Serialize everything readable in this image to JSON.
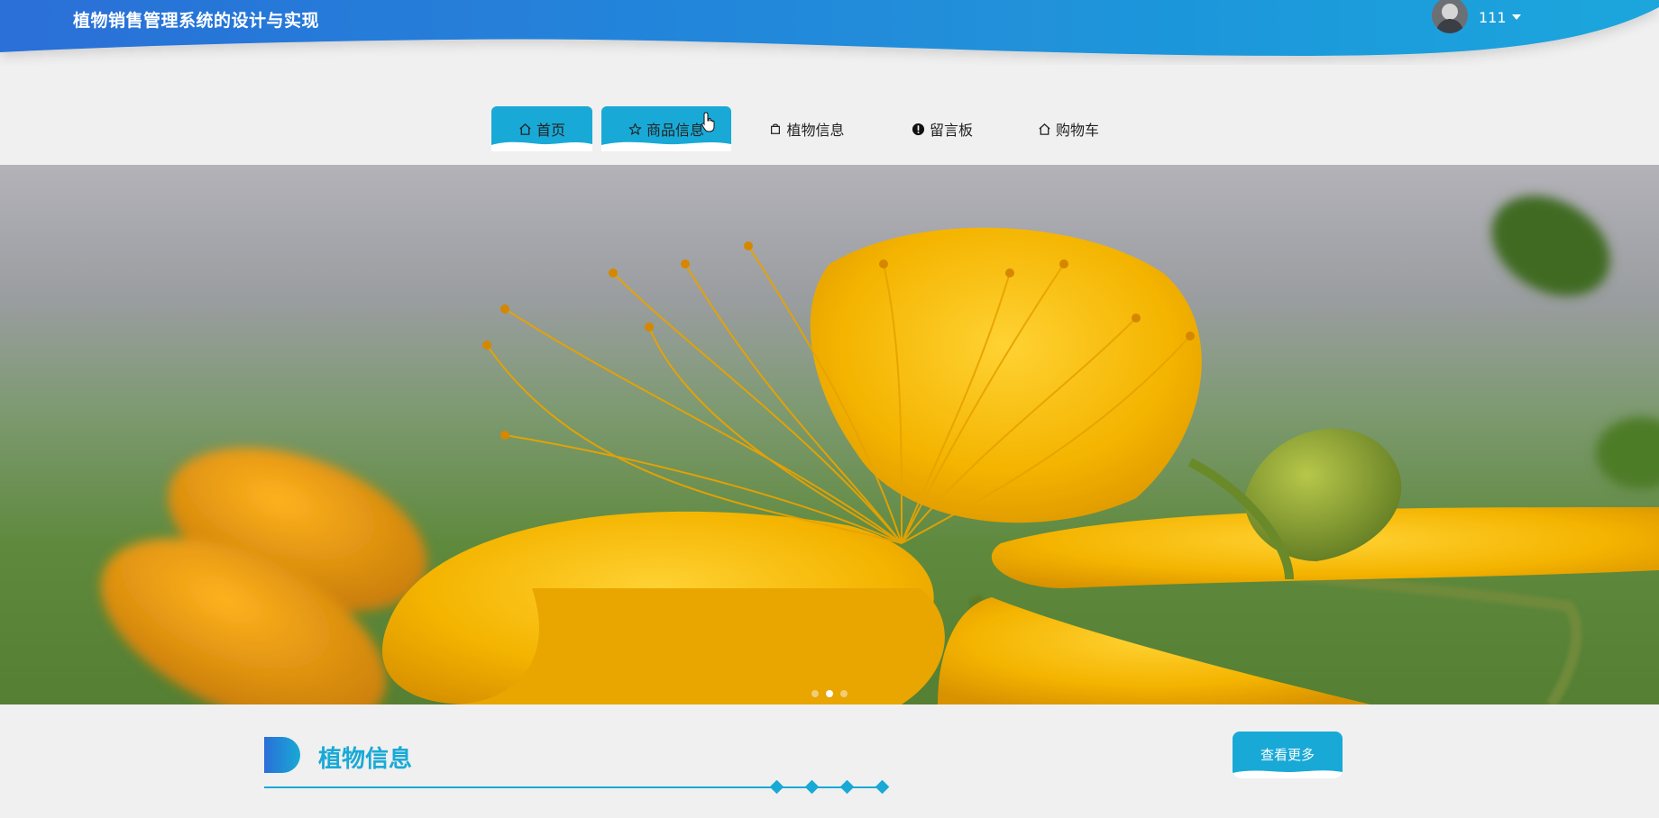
{
  "header": {
    "title": "植物销售管理系统的设计与实现",
    "username": "111"
  },
  "nav": {
    "items": [
      {
        "label": "首页",
        "icon": "home-icon",
        "active": true
      },
      {
        "label": "商品信息",
        "icon": "star-icon",
        "active": true
      },
      {
        "label": "植物信息",
        "icon": "bag-icon",
        "active": false
      },
      {
        "label": "留言板",
        "icon": "alert-icon",
        "active": false
      },
      {
        "label": "购物车",
        "icon": "home-icon",
        "active": false
      }
    ]
  },
  "banner": {
    "slides": 3,
    "current_slide": 2
  },
  "section": {
    "title": "植物信息",
    "more_label": "查看更多"
  },
  "colors": {
    "accent": "#19a9d6",
    "header_gradient_start": "#2a6fd8",
    "header_gradient_end": "#1aa6dc"
  }
}
